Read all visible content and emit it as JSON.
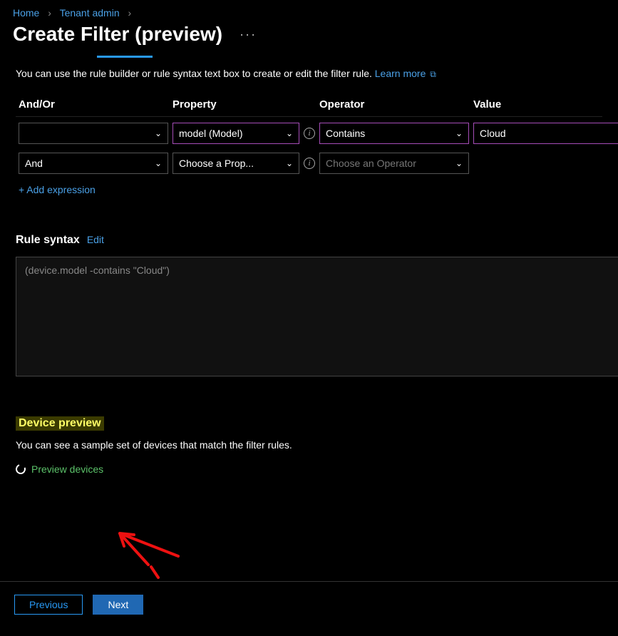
{
  "breadcrumb": {
    "home": "Home",
    "tenant": "Tenant admin"
  },
  "title": "Create Filter (preview)",
  "description": "You can use the rule builder or rule syntax text box to create or edit the filter rule.",
  "learn_more": "Learn more",
  "columns": {
    "andor": "And/Or",
    "property": "Property",
    "operator": "Operator",
    "value": "Value"
  },
  "rows": [
    {
      "andor": "",
      "property": "model (Model)",
      "operator": "Contains",
      "value": "Cloud",
      "highlighted": true
    },
    {
      "andor": "And",
      "property_placeholder": "Choose a Prop...",
      "operator_placeholder": "Choose an Operator",
      "value": "",
      "highlighted": false
    }
  ],
  "add_expression": "+ Add expression",
  "rule_syntax": {
    "label": "Rule syntax",
    "edit": "Edit",
    "text": "(device.model -contains \"Cloud\")"
  },
  "device_preview": {
    "heading": "Device preview",
    "desc": "You can see a sample set of devices that match the filter rules.",
    "link": "Preview devices"
  },
  "buttons": {
    "previous": "Previous",
    "next": "Next"
  }
}
